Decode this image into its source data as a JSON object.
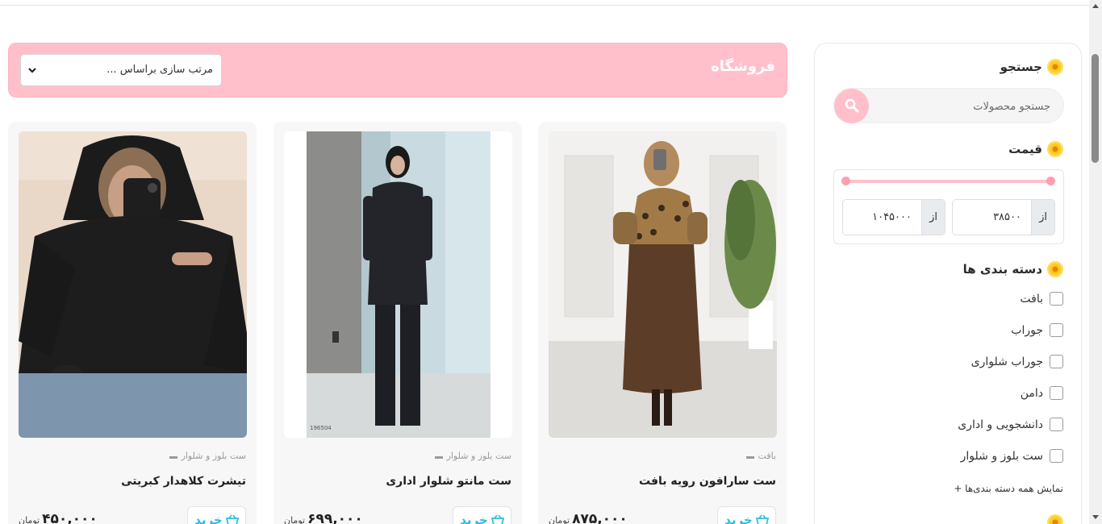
{
  "sidebar": {
    "search_title": "جستجو",
    "search_placeholder": "جستجو محصولات",
    "price_title": "قیمت",
    "price_prefix": "از",
    "price_min": "۳۸۵۰۰",
    "price_max": "۱۰۴۵۰۰۰",
    "categories_title": "دسته بندی ها",
    "categories": [
      {
        "label": "بافت",
        "checked": false
      },
      {
        "label": "جوراب",
        "checked": false
      },
      {
        "label": "جوراب شلواری",
        "checked": false
      },
      {
        "label": "دامن",
        "checked": false
      },
      {
        "label": "دانشجویی و اداری",
        "checked": false
      },
      {
        "label": "ست بلوز و شلوار",
        "checked": false
      }
    ],
    "show_all": "نمایش همه دسته بندی‌ها +"
  },
  "header": {
    "title": "فروشگاه",
    "sort_label": "مرتب سازی براساس ..."
  },
  "products": [
    {
      "category": "بافت",
      "title": "ست سارافون رویه بافت",
      "price": "۸۷۵,۰۰۰",
      "currency": "تومان",
      "buy_label": "خرید"
    },
    {
      "category": "ست بلوز و شلوار",
      "title": "ست مانتو شلوار اداری",
      "price": "۶۹۹,۰۰۰",
      "currency": "تومان",
      "buy_label": "خرید"
    },
    {
      "category": "ست بلوز و شلوار",
      "title": "تیشرت کلاهدار کبریتی",
      "price": "۴۵۰,۰۰۰",
      "currency": "تومان",
      "buy_label": "خرید"
    }
  ],
  "image_text": {
    "watermark": "196504"
  },
  "colors": {
    "accent_pink": "#ffc0cb",
    "buy_text": "#2bc0d8"
  }
}
